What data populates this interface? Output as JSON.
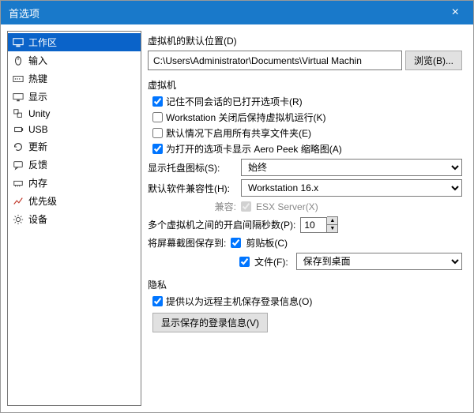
{
  "window": {
    "title": "首选项"
  },
  "sidebar": {
    "items": [
      {
        "label": "工作区"
      },
      {
        "label": "输入"
      },
      {
        "label": "热键"
      },
      {
        "label": "显示"
      },
      {
        "label": "Unity"
      },
      {
        "label": "USB"
      },
      {
        "label": "更新"
      },
      {
        "label": "反馈"
      },
      {
        "label": "内存"
      },
      {
        "label": "优先级"
      },
      {
        "label": "设备"
      }
    ]
  },
  "defaultLocation": {
    "title": "虚拟机的默认位置(D)",
    "path": "C:\\Users\\Administrator\\Documents\\Virtual Machin",
    "browse": "浏览(B)..."
  },
  "vm": {
    "title": "虚拟机",
    "rememberTabs": "记住不同会话的已打开选项卡(R)",
    "keepRunning": "Workstation 关闭后保持虚拟机运行(K)",
    "enableShared": "默认情况下启用所有共享文件夹(E)",
    "aeroPeek": "为打开的选项卡显示 Aero Peek 缩略图(A)",
    "trayLabel": "显示托盘图标(S):",
    "trayValue": "始终",
    "compatLabel": "默认软件兼容性(H):",
    "compatValue": "Workstation 16.x",
    "compatCheckLabel": "兼容:",
    "esx": "ESX Server(X)",
    "delayLabel": "多个虚拟机之间的开启间隔秒数(P):",
    "delayValue": "10",
    "screenshotLabel": "将屏幕截图保存到:",
    "clipboard": "剪贴板(C)",
    "fileLabel": "文件(F):",
    "fileValue": "保存到桌面"
  },
  "privacy": {
    "title": "隐私",
    "offerSave": "提供以为远程主机保存登录信息(O)",
    "showSaved": "显示保存的登录信息(V)"
  }
}
